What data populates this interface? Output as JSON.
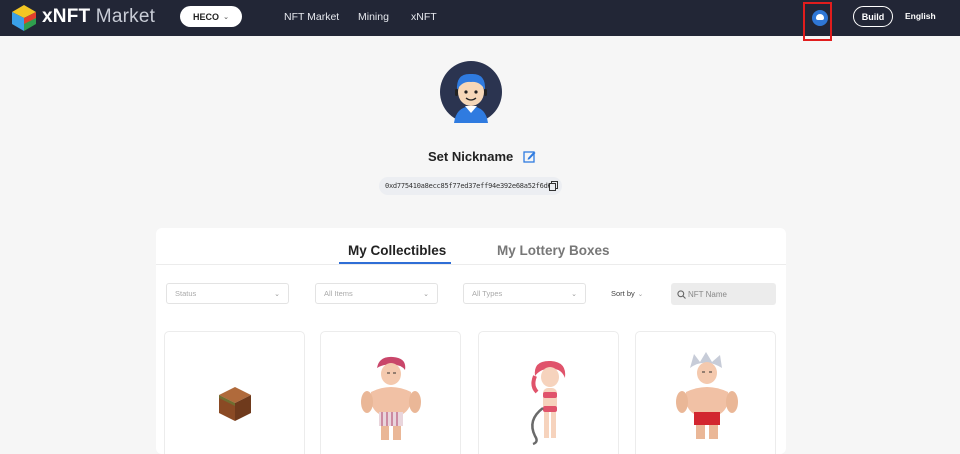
{
  "header": {
    "brand_strong": "xNFT",
    "brand_light": "Market",
    "network": "HECO",
    "nav": [
      "NFT Market",
      "Mining",
      "xNFT"
    ],
    "build_label": "Build",
    "language": "English"
  },
  "profile": {
    "nickname": "Set Nickname",
    "address": "0xd775410a8ecc85f77ed37eff94e392e68a52f6d6"
  },
  "tabs": [
    "My Collectibles",
    "My Lottery Boxes"
  ],
  "filters": {
    "status_placeholder": "Status",
    "items_placeholder": "All Items",
    "types_placeholder": "All Types",
    "sort_label": "Sort by",
    "search_placeholder": "NFT Name"
  },
  "cards": [
    {
      "kind": "cube-box"
    },
    {
      "kind": "muscle-man-pink-hair"
    },
    {
      "kind": "swimsuit-girl-pink-hair"
    },
    {
      "kind": "muscle-man-white-hair"
    }
  ],
  "colors": {
    "topbar": "#222636",
    "accent": "#2f6ed6",
    "highlight_frame": "#e11d1d"
  }
}
